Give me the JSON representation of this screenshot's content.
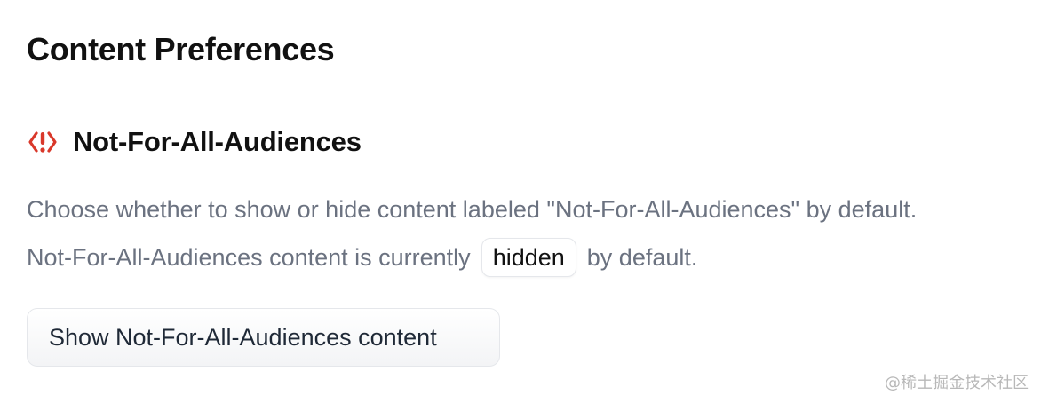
{
  "page": {
    "title": "Content Preferences"
  },
  "nsfw_section": {
    "icon": "alert-octagon-icon",
    "icon_color": "#d9382a",
    "title": "Not-For-All-Audiences",
    "description": "Choose whether to show or hide content labeled \"Not-For-All-Audiences\" by default.",
    "status_prefix": "Not-For-All-Audiences content is currently",
    "status_value": "hidden",
    "status_suffix": "by default.",
    "toggle_button_label": "Show Not-For-All-Audiences content"
  },
  "watermark": "@稀土掘金技术社区"
}
